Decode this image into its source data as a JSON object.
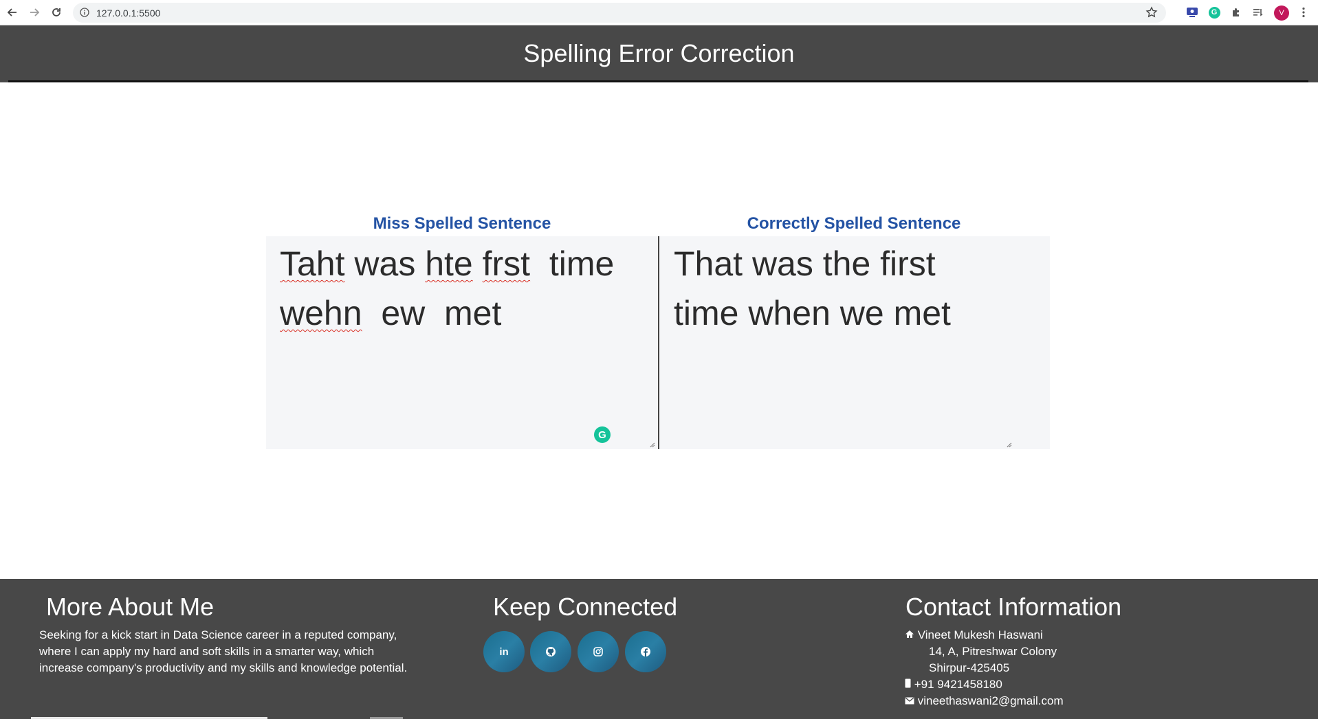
{
  "browser": {
    "url": "127.0.0.1:5500",
    "profile_initial": "V"
  },
  "header": {
    "title": "Spelling Error Correction"
  },
  "input_panel": {
    "label": "Miss Spelled Sentence",
    "words": [
      "Taht",
      " was ",
      "hte",
      " ",
      "frst",
      "  time\n",
      "wehn",
      "  ew  met"
    ]
  },
  "output_panel": {
    "label": "Correctly Spelled Sentence",
    "text": "That was the first\ntime when we met"
  },
  "footer": {
    "about": {
      "heading": "More About Me",
      "text": "Seeking for a kick start in Data Science career in a reputed company, where I can apply my hard and soft skills in a smarter way, which increase company's productivity and my skills and knowledge potential."
    },
    "connect": {
      "heading": "Keep Connected",
      "links": [
        {
          "icon": "linkedin-icon",
          "glyph": "in"
        },
        {
          "icon": "github-icon",
          "glyph": ""
        },
        {
          "icon": "instagram-icon",
          "glyph": ""
        },
        {
          "icon": "facebook-icon",
          "glyph": ""
        }
      ]
    },
    "contact": {
      "heading": "Contact Information",
      "name": "Vineet Mukesh Haswani",
      "address_line1": "14, A, Pitreshwar Colony",
      "address_line2": "Shirpur-425405",
      "phone": "+91 9421458180",
      "email": "vineethaswani2@gmail.com"
    }
  }
}
